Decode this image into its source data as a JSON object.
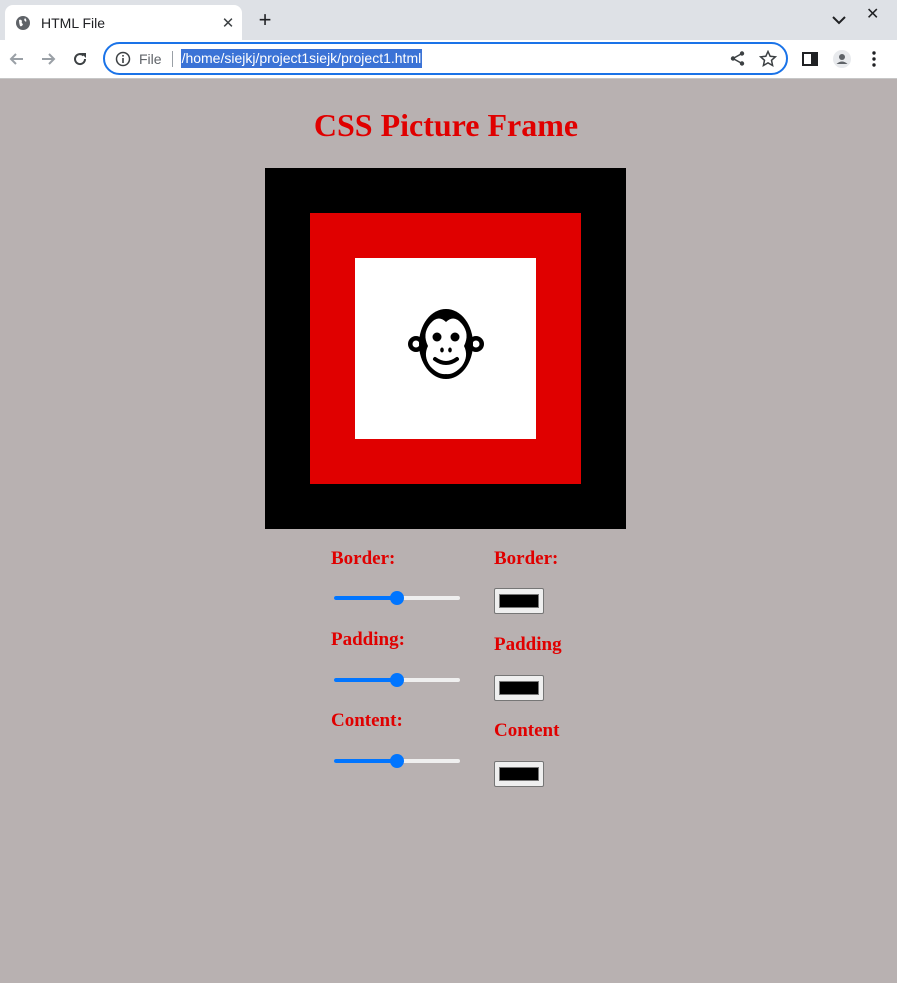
{
  "browser": {
    "tab_title": "HTML File",
    "url_scheme": "File",
    "url": "/home/siejkj/project1siejk/project1.html"
  },
  "page": {
    "title": "CSS Picture Frame",
    "colors": {
      "title": "#e00000",
      "frame_border": "#000000",
      "frame_padding": "#e00000",
      "frame_content": "#ffffff",
      "background": "#b8b1b1",
      "slider_accent": "#0075ff"
    },
    "content_icon": "monkey-icon",
    "controls": {
      "sliders": [
        {
          "label": "Border:",
          "value": 0.5
        },
        {
          "label": "Padding:",
          "value": 0.5
        },
        {
          "label": "Content:",
          "value": 0.5
        }
      ],
      "color_pickers": [
        {
          "label": "Border:",
          "value": "#000000"
        },
        {
          "label": "Padding",
          "value": "#000000"
        },
        {
          "label": "Content",
          "value": "#000000"
        }
      ]
    }
  }
}
